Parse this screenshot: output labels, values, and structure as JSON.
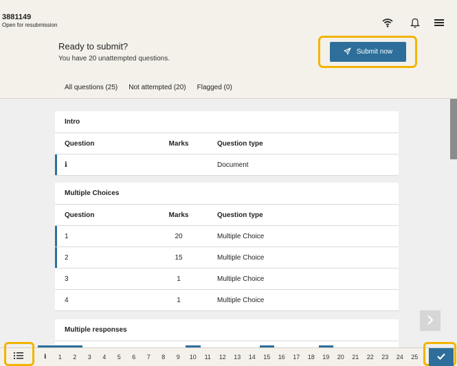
{
  "header": {
    "exam_id": "3881149",
    "status": "Open for resubmission",
    "icons": [
      "wifi-icon",
      "bell-icon",
      "menu-icon"
    ]
  },
  "banner": {
    "title": "Ready to submit?",
    "subtitle": "You have 20 unattempted questions.",
    "submit_label": "Submit now"
  },
  "filters": {
    "all": "All questions (25)",
    "not_attempted": "Not attempted (20)",
    "flagged": "Flagged (0)"
  },
  "sections": [
    {
      "title": "Intro",
      "headers": {
        "question": "Question",
        "marks": "Marks",
        "type": "Question type"
      },
      "rows": [
        {
          "question": "i",
          "marks": "",
          "type": "Document"
        }
      ]
    },
    {
      "title": "Multiple Choices",
      "headers": {
        "question": "Question",
        "marks": "Marks",
        "type": "Question type"
      },
      "rows": [
        {
          "question": "1",
          "marks": "20",
          "type": "Multiple Choice"
        },
        {
          "question": "2",
          "marks": "15",
          "type": "Multiple Choice"
        },
        {
          "question": "3",
          "marks": "1",
          "type": "Multiple Choice"
        },
        {
          "question": "4",
          "marks": "1",
          "type": "Multiple Choice"
        }
      ]
    },
    {
      "title": "Multiple responses"
    }
  ],
  "bottom_nav": {
    "items": [
      "i",
      "1",
      "2",
      "3",
      "4",
      "5",
      "6",
      "7",
      "8",
      "9",
      "10",
      "11",
      "12",
      "13",
      "14",
      "15",
      "16",
      "17",
      "18",
      "19",
      "20",
      "21",
      "22",
      "23",
      "24",
      "25"
    ]
  },
  "colors": {
    "accent": "#2d6f9a",
    "highlight": "#f2b400",
    "header_bg": "#f3f1ea"
  }
}
